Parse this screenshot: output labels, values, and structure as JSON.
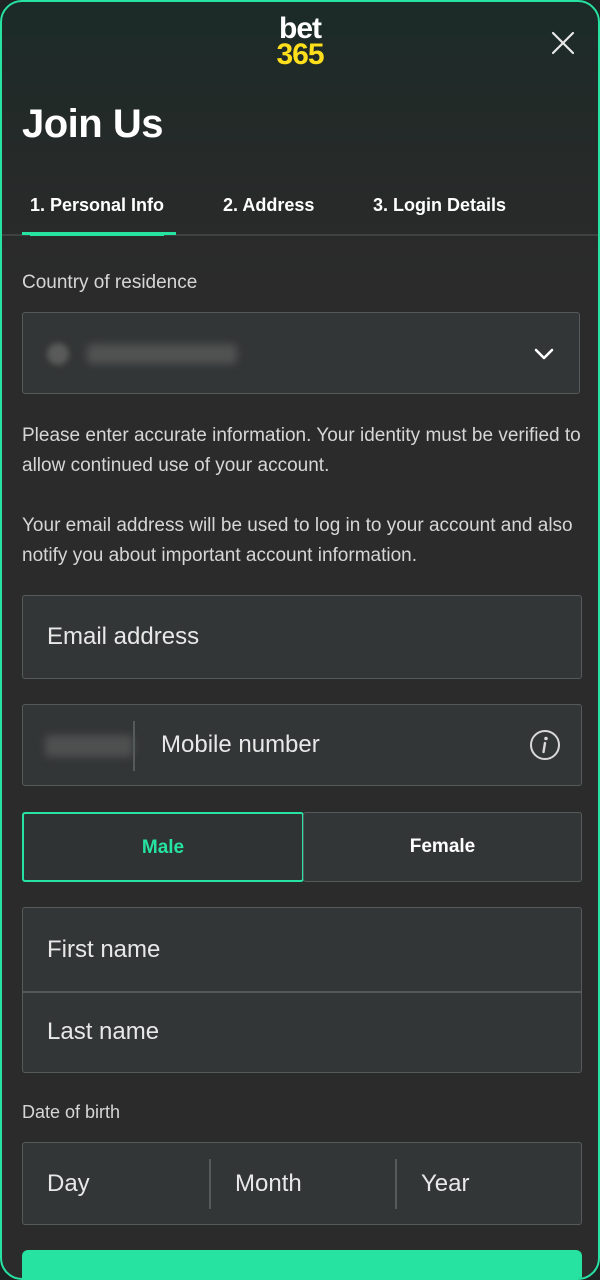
{
  "header": {
    "logo_line1": "bet",
    "logo_line2": "365",
    "title": "Join Us"
  },
  "tabs": [
    {
      "label": "1.  Personal Info",
      "active": true
    },
    {
      "label": "2.  Address",
      "active": false
    },
    {
      "label": "3.  Login Details",
      "active": false
    }
  ],
  "country": {
    "label": "Country of residence"
  },
  "info_text_1": "Please enter accurate information. Your identity must be verified to allow continued use of your account.",
  "info_text_2": "Your email address will be used to log in to your account and also notify you about important account information.",
  "email": {
    "placeholder": "Email address"
  },
  "mobile": {
    "placeholder": "Mobile number"
  },
  "gender": {
    "male": "Male",
    "female": "Female",
    "selected": "Male"
  },
  "name": {
    "first_placeholder": "First name",
    "last_placeholder": "Last name"
  },
  "dob": {
    "label": "Date of birth",
    "day_placeholder": "Day",
    "month_placeholder": "Month",
    "year_placeholder": "Year"
  },
  "colors": {
    "accent": "#26e3a1",
    "logo_yellow": "#ffdf1b",
    "background": "#2b2b2b"
  },
  "icons": [
    "close-icon",
    "chevron-down-icon",
    "info-icon"
  ]
}
